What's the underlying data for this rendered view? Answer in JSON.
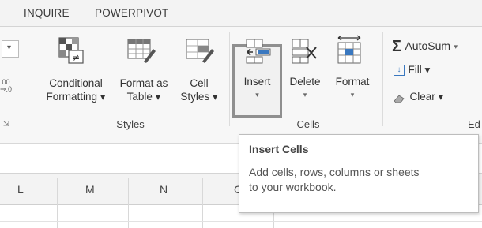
{
  "tabs": [
    {
      "label": "INQUIRE"
    },
    {
      "label": "POWERPIVOT"
    }
  ],
  "ribbon": {
    "left_stub": {
      "decimal_top": ".00",
      "decimal_bottom": "⇒.0",
      "caret": "▾"
    },
    "styles_group": {
      "label": "Styles",
      "conditional_formatting": {
        "line1": "Conditional",
        "line2": "Formatting ▾"
      },
      "format_as_table": {
        "line1": "Format as",
        "line2": "Table ▾"
      },
      "cell_styles": {
        "line1": "Cell",
        "line2": "Styles ▾"
      }
    },
    "cells_group": {
      "label": "Cells",
      "insert": {
        "label": "Insert",
        "caret": "▾"
      },
      "delete": {
        "label": "Delete",
        "caret": "▾"
      },
      "format": {
        "label": "Format",
        "caret": "▾"
      }
    },
    "editing_group": {
      "label_partial": "Ed",
      "autosum": {
        "symbol": "Σ",
        "label": "AutoSum",
        "caret": "▾"
      },
      "fill": {
        "label": "Fill ▾"
      },
      "clear": {
        "label": "Clear ▾"
      }
    }
  },
  "sheet": {
    "columns": [
      "L",
      "M",
      "N",
      "C"
    ]
  },
  "tooltip": {
    "title": "Insert Cells",
    "description_line1": "Add cells, rows, columns or sheets",
    "description_line2": "to your workbook."
  },
  "colors": {
    "highlight_border": "#8f8f8f",
    "ribbon_bg": "#f7f7f7",
    "icon_blue": "#3a78c0"
  }
}
